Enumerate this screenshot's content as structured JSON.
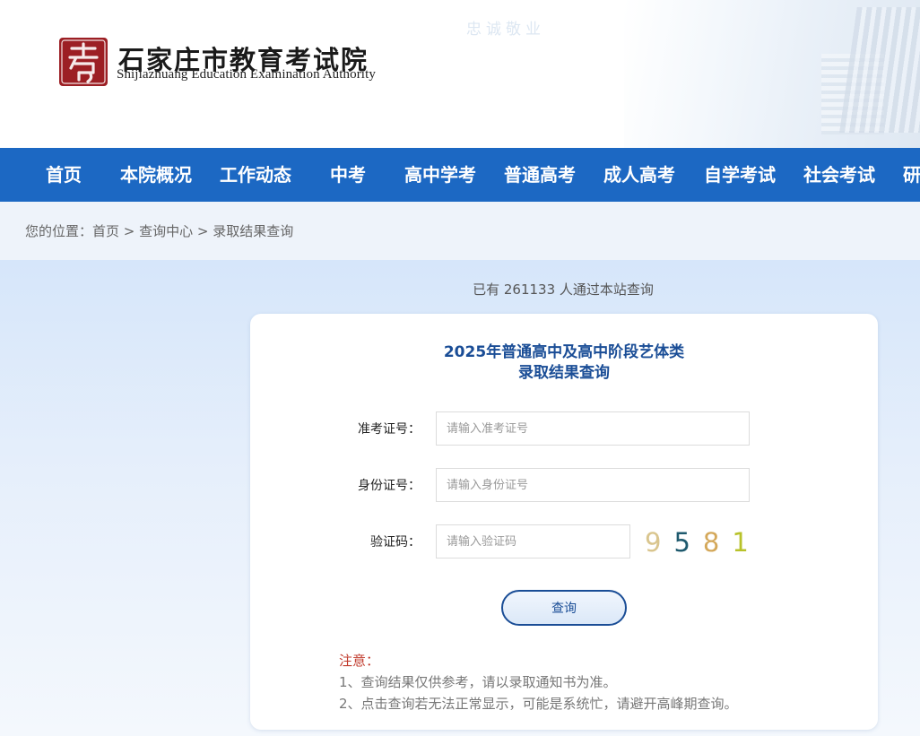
{
  "header": {
    "slogan": "忠诚敬业",
    "org_name_cn": "石家庄市教育考试院",
    "org_name_en": "Shijiazhuang Education Examination Authority"
  },
  "nav": {
    "items": [
      "首页",
      "本院概况",
      "工作动态",
      "中考",
      "高中学考",
      "普通高考",
      "成人高考",
      "自学考试",
      "社会考试",
      "研"
    ]
  },
  "breadcrumb": {
    "prefix": "您的位置：",
    "items": [
      "首页",
      "查询中心",
      "录取结果查询"
    ],
    "separator": " > "
  },
  "counter": {
    "text_before": "已有 ",
    "count": "261133",
    "text_after": " 人通过本站查询"
  },
  "form": {
    "title_line1": "2025年普通高中及高中阶段艺体类",
    "title_line2": "录取结果查询",
    "exam_no": {
      "label": "准考证号：",
      "placeholder": "请输入准考证号",
      "value": ""
    },
    "id_no": {
      "label": "身份证号：",
      "placeholder": "请输入身份证号",
      "value": ""
    },
    "captcha": {
      "label": "验证码：",
      "placeholder": "请输入验证码",
      "value": ""
    },
    "captcha_digits": [
      {
        "digit": "9",
        "color": "#d9c58e"
      },
      {
        "digit": "5",
        "color": "#1f5a6e"
      },
      {
        "digit": "8",
        "color": "#d4a85a"
      },
      {
        "digit": "1",
        "color": "#b8c22a"
      }
    ],
    "submit_label": "查询"
  },
  "notes": {
    "title": "注意：",
    "lines": [
      "1、查询结果仅供参考，请以录取通知书为准。",
      "2、点击查询若无法正常显示，可能是系统忙，请避开高峰期查询。"
    ]
  },
  "colors": {
    "nav_bg": "#1c68c3",
    "title_blue": "#1a4d96",
    "note_red": "#c0392b",
    "seal_red": "#9c1f24"
  }
}
